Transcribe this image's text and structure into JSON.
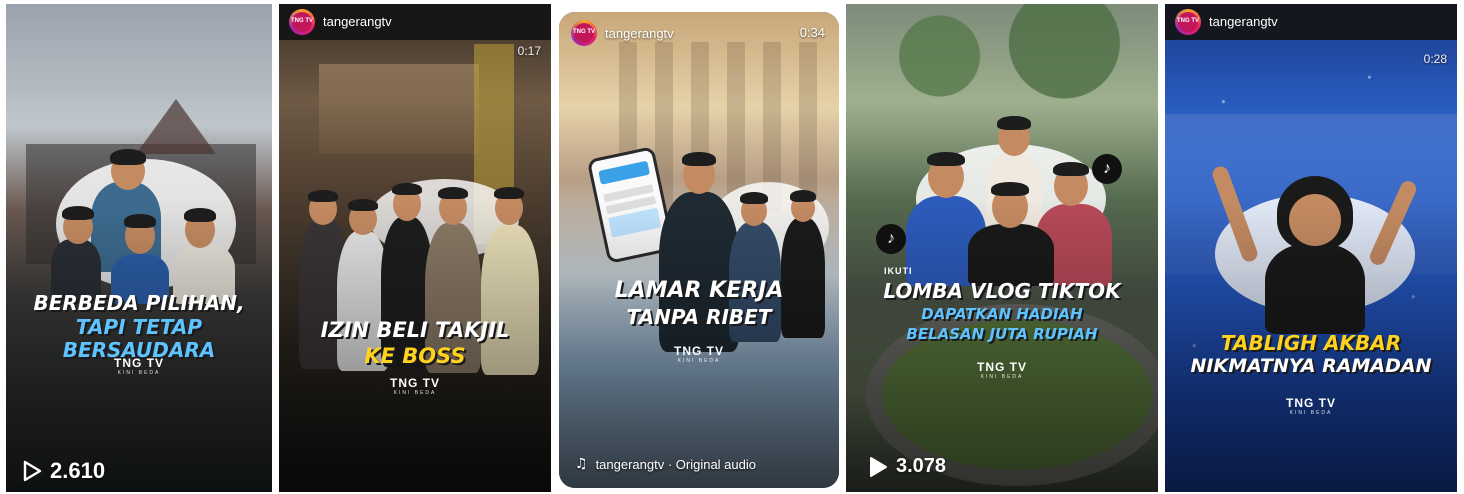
{
  "cards": [
    {
      "caption_line1": "BERBEDA PILIHAN,",
      "caption_line2": "TAPI TETAP BERSAUDARA",
      "logo": "TNG TV",
      "logo_sub": "KINI BEDA",
      "views": "2.610",
      "views_icon": "play-outline-icon"
    },
    {
      "account": "tangerangtv",
      "duration": "0:17",
      "caption_line1": "IZIN BELI TAKJIL",
      "caption_line2": "KE BOSS",
      "logo": "TNG TV",
      "logo_sub": "KINI BEDA"
    },
    {
      "account": "tangerangtv",
      "duration": "0:34",
      "caption_line1": "LAMAR KERJA",
      "caption_line2": "TANPA RIBET",
      "logo": "TNG TV",
      "logo_sub": "KINI BEDA",
      "audio": "tangerangtv · Original audio",
      "audio_icon": "music-note-icon"
    },
    {
      "kicker": "IKUTI",
      "caption_line1": "LOMBA VLOG TIKTOK",
      "caption_line2": "DAPATKAN HADIAH",
      "caption_line3": "BELASAN JUTA RUPIAH",
      "logo": "TNG TV",
      "logo_sub": "KINI BEDA",
      "views": "3.078",
      "views_icon": "play-filled-icon"
    },
    {
      "account": "tangerangtv",
      "duration": "0:28",
      "caption_line1": "TABLIGH AKBAR",
      "caption_line2": "NIKMATNYA RAMADAN",
      "logo": "TNG TV",
      "logo_sub": "KINI BEDA"
    }
  ],
  "avatar_text": "TNG TV",
  "colors": {
    "caption_blue": "#5ec3ff",
    "caption_yellow": "#ffd21f",
    "topbar": "#141414"
  }
}
